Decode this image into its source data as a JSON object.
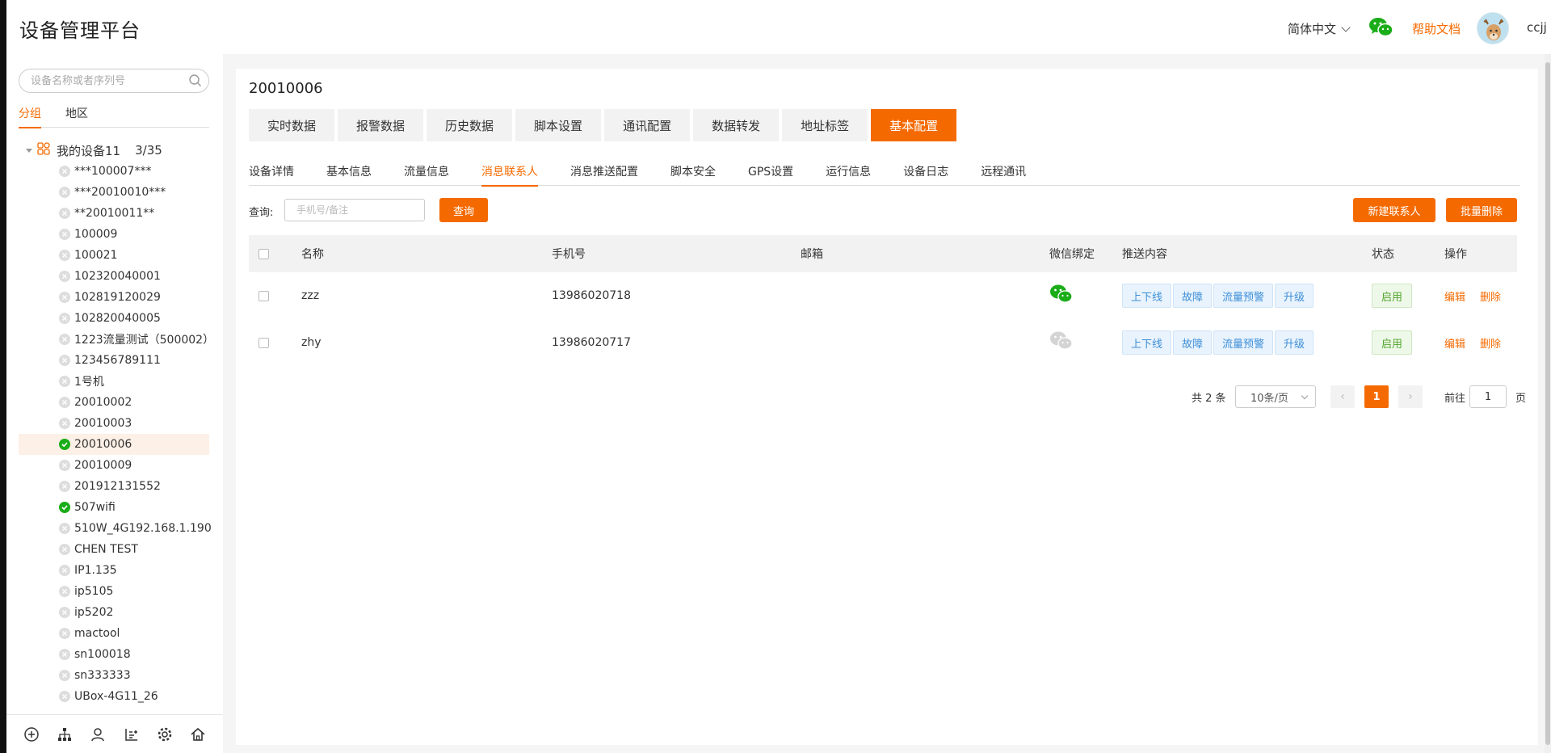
{
  "header": {
    "title": "设备管理平台",
    "language": "简体中文",
    "help": "帮助文档",
    "username": "ccjj"
  },
  "sidebar": {
    "search_placeholder": "设备名称或者序列号",
    "tabs": [
      "分组",
      "地区"
    ],
    "active_tab": 0,
    "root": {
      "label": "我的设备11",
      "count": "3/35"
    },
    "devices": [
      {
        "name": "***100007***",
        "online": false
      },
      {
        "name": "***20010010***",
        "online": false
      },
      {
        "name": "**20010011**",
        "online": false
      },
      {
        "name": "100009",
        "online": false
      },
      {
        "name": "100021",
        "online": false
      },
      {
        "name": "102320040001",
        "online": false
      },
      {
        "name": "102819120029",
        "online": false
      },
      {
        "name": "102820040005",
        "online": false
      },
      {
        "name": "1223流量测试（500002）",
        "online": false
      },
      {
        "name": "123456789111",
        "online": false
      },
      {
        "name": "1号机",
        "online": false
      },
      {
        "name": "20010002",
        "online": false
      },
      {
        "name": "20010003",
        "online": false
      },
      {
        "name": "20010006",
        "online": true,
        "selected": true
      },
      {
        "name": "20010009",
        "online": false
      },
      {
        "name": "201912131552",
        "online": false
      },
      {
        "name": "507wifi",
        "online": true
      },
      {
        "name": "510W_4G192.168.1.190",
        "online": false
      },
      {
        "name": "CHEN TEST",
        "online": false
      },
      {
        "name": "IP1.135",
        "online": false
      },
      {
        "name": "ip5105",
        "online": false
      },
      {
        "name": "ip5202",
        "online": false
      },
      {
        "name": "mactool",
        "online": false
      },
      {
        "name": "sn100018",
        "online": false
      },
      {
        "name": "sn333333",
        "online": false
      },
      {
        "name": "UBox-4G11_26",
        "online": false
      }
    ],
    "footer_icons": [
      "add-circle-icon",
      "org-tree-icon",
      "user-icon",
      "list-settings-icon",
      "settings-gear-icon",
      "home-icon"
    ]
  },
  "main": {
    "device_title": "20010006",
    "top_tabs": [
      "实时数据",
      "报警数据",
      "历史数据",
      "脚本设置",
      "通讯配置",
      "数据转发",
      "地址标签",
      "基本配置"
    ],
    "active_top_tab": 7,
    "sub_tabs": [
      "设备详情",
      "基本信息",
      "流量信息",
      "消息联系人",
      "消息推送配置",
      "脚本安全",
      "GPS设置",
      "运行信息",
      "设备日志",
      "远程通讯"
    ],
    "active_sub_tab": 3,
    "query_label": "查询:",
    "query_placeholder": "手机号/备注",
    "query_button": "查询",
    "new_contact_button": "新建联系人",
    "batch_delete_button": "批量删除",
    "table": {
      "headers": [
        "名称",
        "手机号",
        "邮箱",
        "微信绑定",
        "推送内容",
        "状态",
        "操作"
      ],
      "rows": [
        {
          "name": "zzz",
          "phone": "13986020718",
          "email": "",
          "wechat_bound": true,
          "push": [
            "上下线",
            "故障",
            "流量预警",
            "升级"
          ],
          "status": "启用",
          "edit": "编辑",
          "delete": "删除"
        },
        {
          "name": "zhy",
          "phone": "13986020717",
          "email": "",
          "wechat_bound": false,
          "push": [
            "上下线",
            "故障",
            "流量预警",
            "升级"
          ],
          "status": "启用",
          "edit": "编辑",
          "delete": "删除"
        }
      ]
    },
    "pagination": {
      "total": "共 2 条",
      "page_size": "10条/页",
      "current_page": "1",
      "goto_label": "前往",
      "goto_value": "1",
      "page_suffix": "页"
    }
  },
  "colors": {
    "accent": "#f56a00",
    "online": "#1aad19",
    "wechat": "#1aad19",
    "tag_blue": "#3f8fd8",
    "status_green": "#52a52b"
  }
}
